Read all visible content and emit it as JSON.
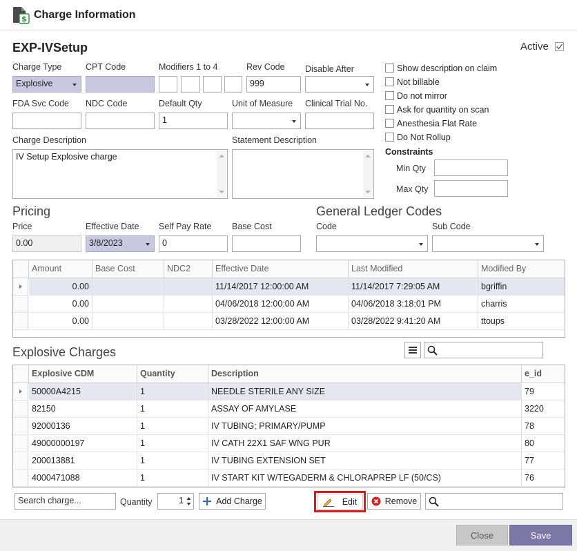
{
  "window": {
    "title": "Charge Information"
  },
  "header": {
    "name": "EXP-IVSetup",
    "active_label": "Active",
    "active_checked": true
  },
  "fields": {
    "charge_type": {
      "label": "Charge Type",
      "value": "Explosive"
    },
    "cpt_code": {
      "label": "CPT Code",
      "value": ""
    },
    "modifiers": {
      "label": "Modifiers 1 to 4",
      "values": [
        "",
        "",
        "",
        ""
      ]
    },
    "rev_code": {
      "label": "Rev Code",
      "value": "999"
    },
    "disable_after": {
      "label": "Disable After",
      "value": ""
    },
    "fda_svc_code": {
      "label": "FDA Svc Code",
      "value": ""
    },
    "ndc_code": {
      "label": "NDC Code",
      "value": ""
    },
    "default_qty": {
      "label": "Default Qty",
      "value": "1"
    },
    "unit_of_measure": {
      "label": "Unit of Measure",
      "value": ""
    },
    "clinical_trial_no": {
      "label": "Clinical Trial No.",
      "value": ""
    },
    "charge_description": {
      "label": "Charge Description",
      "value": "IV Setup Explosive charge"
    },
    "statement_description": {
      "label": "Statement Description",
      "value": ""
    }
  },
  "options": [
    {
      "label": "Show description on claim",
      "checked": false
    },
    {
      "label": "Not billable",
      "checked": false
    },
    {
      "label": "Do not mirror",
      "checked": false
    },
    {
      "label": "Ask for quantity on scan",
      "checked": false
    },
    {
      "label": "Anesthesia Flat Rate",
      "checked": false
    },
    {
      "label": "Do Not Rollup",
      "checked": false
    }
  ],
  "constraints": {
    "title": "Constraints",
    "min_qty": {
      "label": "Min Qty",
      "value": ""
    },
    "max_qty": {
      "label": "Max Qty",
      "value": ""
    }
  },
  "pricing": {
    "title": "Pricing",
    "price": {
      "label": "Price",
      "value": "0.00"
    },
    "effective_date": {
      "label": "Effective Date",
      "value": "3/8/2023"
    },
    "self_pay_rate": {
      "label": "Self Pay Rate",
      "value": "0"
    },
    "base_cost": {
      "label": "Base Cost",
      "value": ""
    }
  },
  "gl_codes": {
    "title": "General Ledger Codes",
    "code": {
      "label": "Code",
      "value": ""
    },
    "sub_code": {
      "label": "Sub Code",
      "value": ""
    }
  },
  "price_history": {
    "columns": [
      "Amount",
      "Base Cost",
      "NDC2",
      "Effective Date",
      "Last Modified",
      "Modified By"
    ],
    "rows": [
      [
        "0.00",
        "",
        "",
        "11/14/2017 12:00:00 AM",
        "11/14/2017 7:29:05 AM",
        "bgriffin"
      ],
      [
        "0.00",
        "",
        "",
        "04/06/2018 12:00:00 AM",
        "04/06/2018 3:18:01 PM",
        "charris"
      ],
      [
        "0.00",
        "",
        "",
        "03/28/2022 12:00:00 AM",
        "03/28/2022 9:41:20 AM",
        "ttoups"
      ]
    ]
  },
  "explosive": {
    "title": "Explosive Charges",
    "columns": [
      "Explosive CDM",
      "Quantity",
      "Description",
      "e_id"
    ],
    "rows": [
      [
        "50000A4215",
        "1",
        "NEEDLE STERILE ANY SIZE",
        "79"
      ],
      [
        "82150",
        "1",
        "ASSAY OF AMYLASE",
        "3220"
      ],
      [
        "92000136",
        "1",
        "IV TUBING; PRIMARY/PUMP",
        "78"
      ],
      [
        "49000000197",
        "1",
        "IV CATH 22X1 SAF WNG PUR",
        "80"
      ],
      [
        "200013881",
        "1",
        "IV TUBING EXTENSION SET",
        "77"
      ],
      [
        "4000471088",
        "1",
        "IV START KIT W/TEGADERM & CHLORAPREP LF (50/CS)",
        "76"
      ]
    ],
    "search_top_value": ""
  },
  "bottom_bar": {
    "search_placeholder": "Search charge...",
    "quantity_label": "Quantity",
    "quantity_value": "1",
    "add_charge": "Add Charge",
    "edit": "Edit",
    "remove": "Remove",
    "filter_value": ""
  },
  "footer": {
    "close": "Close",
    "save": "Save"
  },
  "colors": {
    "save_button": "#7b78a8",
    "highlight": "#d9191c",
    "selected_row": "#e6e6f0"
  }
}
